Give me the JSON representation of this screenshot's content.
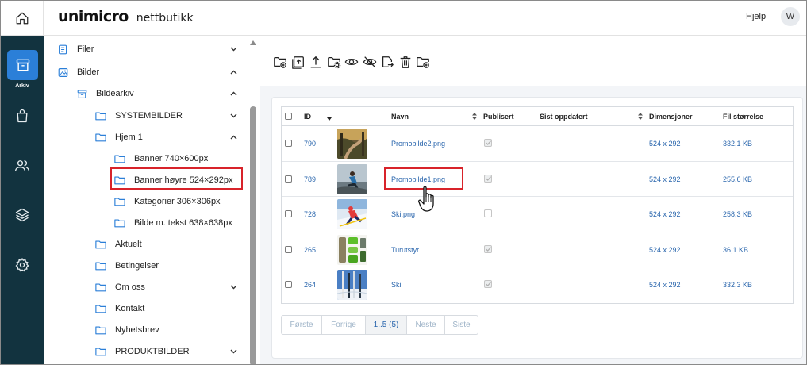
{
  "header": {
    "logo_main": "unimicro",
    "logo_sub": "nettbutikk",
    "help": "Hjelp",
    "avatar": "W"
  },
  "nav": {
    "active_label": "Arkiv",
    "icons": [
      "home-icon",
      "archive-icon",
      "shopping-bag-icon",
      "users-icon",
      "layers-icon",
      "gear-icon"
    ]
  },
  "tree": {
    "items": [
      {
        "label": "Filer"
      },
      {
        "label": "Bilder"
      },
      {
        "label": "Bildearkiv"
      },
      {
        "label": "SYSTEMBILDER"
      },
      {
        "label": "Hjem 1"
      },
      {
        "label": "Banner 740×600px"
      },
      {
        "label": "Banner høyre 524×292px"
      },
      {
        "label": "Kategorier 306×306px"
      },
      {
        "label": "Bilde m. tekst 638×638px"
      },
      {
        "label": "Aktuelt"
      },
      {
        "label": "Betingelser"
      },
      {
        "label": "Om oss"
      },
      {
        "label": "Kontakt"
      },
      {
        "label": "Nyhetsbrev"
      },
      {
        "label": "PRODUKTBILDER"
      }
    ]
  },
  "toolbar": {
    "icons": [
      "new-folder-icon",
      "upload-folder-icon",
      "upload-icon",
      "folder-settings-icon",
      "eye-icon",
      "eye-off-icon",
      "move-icon",
      "trash-icon",
      "add-folder-icon"
    ]
  },
  "table": {
    "headers": {
      "id": "ID",
      "name": "Navn",
      "published": "Publisert",
      "updated": "Sist oppdatert",
      "dimensions": "Dimensjoner",
      "filesize": "Fil størrelse"
    },
    "rows": [
      {
        "id": "790",
        "name": "Promobilde2.png",
        "dimensions": "524 x 292",
        "size": "332,1 KB",
        "published": true
      },
      {
        "id": "789",
        "name": "Promobilde1.png",
        "dimensions": "524 x 292",
        "size": "255,6 KB",
        "published": true
      },
      {
        "id": "728",
        "name": "Ski.png",
        "dimensions": "524 x 292",
        "size": "258,3 KB",
        "published": false
      },
      {
        "id": "265",
        "name": "Turutstyr",
        "dimensions": "524 x 292",
        "size": "36,1 KB",
        "published": true
      },
      {
        "id": "264",
        "name": "Ski",
        "dimensions": "524 x 292",
        "size": "332,3 KB",
        "published": true
      }
    ]
  },
  "pager": {
    "first": "Første",
    "prev": "Forrige",
    "current": "1..5 (5)",
    "next": "Neste",
    "last": "Siste"
  },
  "colors": {
    "nav_bg": "#12333f",
    "accent": "#2b7fd8",
    "highlight": "#d8232a",
    "link": "#2a66ad"
  }
}
